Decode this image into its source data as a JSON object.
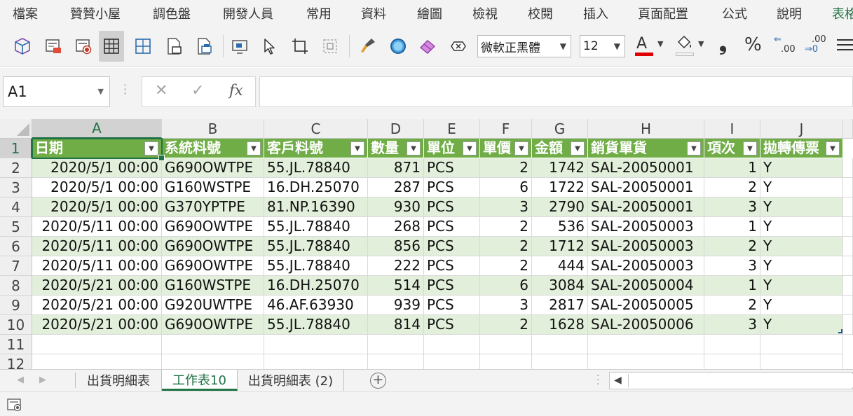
{
  "ribbon": {
    "tabs": [
      "檔案",
      "贊贊小屋",
      "調色盤",
      "開發人員",
      "常用",
      "資料",
      "繪圖",
      "檢視",
      "校閱",
      "插入",
      "頁面配置",
      "公式",
      "說明",
      "表格"
    ]
  },
  "toolbar": {
    "icons": [
      "3d-model-icon",
      "print-preview-icon",
      "record-macro-icon",
      "all-borders-icon",
      "border-grid-icon",
      "page-setup-icon",
      "print-area-icon",
      "select-objects-icon",
      "pointer-icon",
      "crop-icon",
      "selection-pane-icon",
      "format-painter-icon",
      "circle-shape-icon",
      "eraser-icon",
      "clear-format-icon"
    ],
    "font_name": "微軟正黑體",
    "font_size": "12",
    "font_color_glyph": "A",
    "font_color": "#e00000",
    "comma_glyph": "❟",
    "percent_glyph": "%",
    "decimal_decrease": ".00",
    "decimal_increase": ".00"
  },
  "formula_bar": {
    "name_box": "A1",
    "cancel_glyph": "✕",
    "enter_glyph": "✓",
    "fx_glyph": "fx",
    "formula": ""
  },
  "grid": {
    "columns": [
      "A",
      "B",
      "C",
      "D",
      "E",
      "F",
      "G",
      "H",
      "I",
      "J"
    ],
    "row_numbers": [
      "1",
      "2",
      "3",
      "4",
      "5",
      "6",
      "7",
      "8",
      "9",
      "10",
      "11",
      "12"
    ],
    "header": [
      "日期",
      "系統料號",
      "客戶料號",
      "數量",
      "單位",
      "單價",
      "金額",
      "銷貨單貨",
      "項次",
      "拋轉傳票"
    ],
    "rows": [
      [
        "2020/5/1 00:00",
        "G690OWTPE",
        "55.JL.78840",
        "871",
        "PCS",
        "2",
        "1742",
        "SAL-20050001",
        "1",
        "Y"
      ],
      [
        "2020/5/1 00:00",
        "G160WSTPE",
        "16.DH.25070",
        "287",
        "PCS",
        "6",
        "1722",
        "SAL-20050001",
        "2",
        "Y"
      ],
      [
        "2020/5/1 00:00",
        "G370YPTPE",
        "81.NP.16390",
        "930",
        "PCS",
        "3",
        "2790",
        "SAL-20050001",
        "3",
        "Y"
      ],
      [
        "2020/5/11 00:00",
        "G690OWTPE",
        "55.JL.78840",
        "268",
        "PCS",
        "2",
        "536",
        "SAL-20050003",
        "1",
        "Y"
      ],
      [
        "2020/5/11 00:00",
        "G690OWTPE",
        "55.JL.78840",
        "856",
        "PCS",
        "2",
        "1712",
        "SAL-20050003",
        "2",
        "Y"
      ],
      [
        "2020/5/11 00:00",
        "G690OWTPE",
        "55.JL.78840",
        "222",
        "PCS",
        "2",
        "444",
        "SAL-20050003",
        "3",
        "Y"
      ],
      [
        "2020/5/21 00:00",
        "G160WSTPE",
        "16.DH.25070",
        "514",
        "PCS",
        "6",
        "3084",
        "SAL-20050004",
        "1",
        "Y"
      ],
      [
        "2020/5/21 00:00",
        "G920UWTPE",
        "46.AF.63930",
        "939",
        "PCS",
        "3",
        "2817",
        "SAL-20050005",
        "2",
        "Y"
      ],
      [
        "2020/5/21 00:00",
        "G690OWTPE",
        "55.JL.78840",
        "814",
        "PCS",
        "2",
        "1628",
        "SAL-20050006",
        "3",
        "Y"
      ]
    ],
    "header_color": "#70ad47",
    "band_color": "#e2efda",
    "selected_cell": "A1"
  },
  "sheets": {
    "tabs": [
      "出貨明細表",
      "工作表10",
      "出貨明細表 (2)"
    ],
    "active_index": 1,
    "add_glyph": "+"
  },
  "colors": {
    "accent": "#217346"
  }
}
